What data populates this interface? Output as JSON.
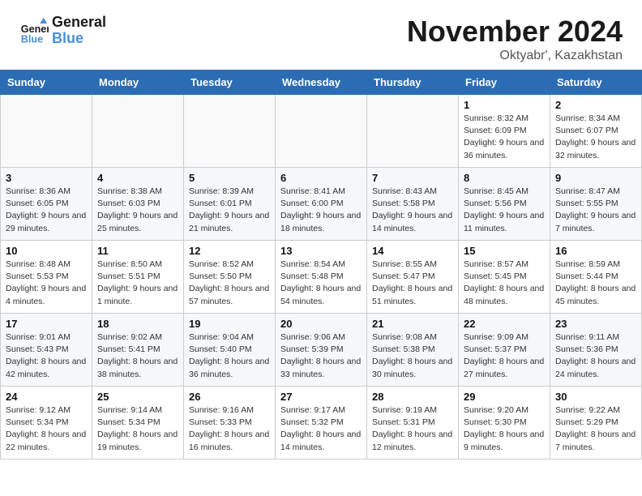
{
  "header": {
    "logo_line1": "General",
    "logo_line2": "Blue",
    "month": "November 2024",
    "location": "Oktyabr', Kazakhstan"
  },
  "weekdays": [
    "Sunday",
    "Monday",
    "Tuesday",
    "Wednesday",
    "Thursday",
    "Friday",
    "Saturday"
  ],
  "weeks": [
    [
      {
        "day": "",
        "info": ""
      },
      {
        "day": "",
        "info": ""
      },
      {
        "day": "",
        "info": ""
      },
      {
        "day": "",
        "info": ""
      },
      {
        "day": "",
        "info": ""
      },
      {
        "day": "1",
        "info": "Sunrise: 8:32 AM\nSunset: 6:09 PM\nDaylight: 9 hours and 36 minutes."
      },
      {
        "day": "2",
        "info": "Sunrise: 8:34 AM\nSunset: 6:07 PM\nDaylight: 9 hours and 32 minutes."
      }
    ],
    [
      {
        "day": "3",
        "info": "Sunrise: 8:36 AM\nSunset: 6:05 PM\nDaylight: 9 hours and 29 minutes."
      },
      {
        "day": "4",
        "info": "Sunrise: 8:38 AM\nSunset: 6:03 PM\nDaylight: 9 hours and 25 minutes."
      },
      {
        "day": "5",
        "info": "Sunrise: 8:39 AM\nSunset: 6:01 PM\nDaylight: 9 hours and 21 minutes."
      },
      {
        "day": "6",
        "info": "Sunrise: 8:41 AM\nSunset: 6:00 PM\nDaylight: 9 hours and 18 minutes."
      },
      {
        "day": "7",
        "info": "Sunrise: 8:43 AM\nSunset: 5:58 PM\nDaylight: 9 hours and 14 minutes."
      },
      {
        "day": "8",
        "info": "Sunrise: 8:45 AM\nSunset: 5:56 PM\nDaylight: 9 hours and 11 minutes."
      },
      {
        "day": "9",
        "info": "Sunrise: 8:47 AM\nSunset: 5:55 PM\nDaylight: 9 hours and 7 minutes."
      }
    ],
    [
      {
        "day": "10",
        "info": "Sunrise: 8:48 AM\nSunset: 5:53 PM\nDaylight: 9 hours and 4 minutes."
      },
      {
        "day": "11",
        "info": "Sunrise: 8:50 AM\nSunset: 5:51 PM\nDaylight: 9 hours and 1 minute."
      },
      {
        "day": "12",
        "info": "Sunrise: 8:52 AM\nSunset: 5:50 PM\nDaylight: 8 hours and 57 minutes."
      },
      {
        "day": "13",
        "info": "Sunrise: 8:54 AM\nSunset: 5:48 PM\nDaylight: 8 hours and 54 minutes."
      },
      {
        "day": "14",
        "info": "Sunrise: 8:55 AM\nSunset: 5:47 PM\nDaylight: 8 hours and 51 minutes."
      },
      {
        "day": "15",
        "info": "Sunrise: 8:57 AM\nSunset: 5:45 PM\nDaylight: 8 hours and 48 minutes."
      },
      {
        "day": "16",
        "info": "Sunrise: 8:59 AM\nSunset: 5:44 PM\nDaylight: 8 hours and 45 minutes."
      }
    ],
    [
      {
        "day": "17",
        "info": "Sunrise: 9:01 AM\nSunset: 5:43 PM\nDaylight: 8 hours and 42 minutes."
      },
      {
        "day": "18",
        "info": "Sunrise: 9:02 AM\nSunset: 5:41 PM\nDaylight: 8 hours and 38 minutes."
      },
      {
        "day": "19",
        "info": "Sunrise: 9:04 AM\nSunset: 5:40 PM\nDaylight: 8 hours and 36 minutes."
      },
      {
        "day": "20",
        "info": "Sunrise: 9:06 AM\nSunset: 5:39 PM\nDaylight: 8 hours and 33 minutes."
      },
      {
        "day": "21",
        "info": "Sunrise: 9:08 AM\nSunset: 5:38 PM\nDaylight: 8 hours and 30 minutes."
      },
      {
        "day": "22",
        "info": "Sunrise: 9:09 AM\nSunset: 5:37 PM\nDaylight: 8 hours and 27 minutes."
      },
      {
        "day": "23",
        "info": "Sunrise: 9:11 AM\nSunset: 5:36 PM\nDaylight: 8 hours and 24 minutes."
      }
    ],
    [
      {
        "day": "24",
        "info": "Sunrise: 9:12 AM\nSunset: 5:34 PM\nDaylight: 8 hours and 22 minutes."
      },
      {
        "day": "25",
        "info": "Sunrise: 9:14 AM\nSunset: 5:34 PM\nDaylight: 8 hours and 19 minutes."
      },
      {
        "day": "26",
        "info": "Sunrise: 9:16 AM\nSunset: 5:33 PM\nDaylight: 8 hours and 16 minutes."
      },
      {
        "day": "27",
        "info": "Sunrise: 9:17 AM\nSunset: 5:32 PM\nDaylight: 8 hours and 14 minutes."
      },
      {
        "day": "28",
        "info": "Sunrise: 9:19 AM\nSunset: 5:31 PM\nDaylight: 8 hours and 12 minutes."
      },
      {
        "day": "29",
        "info": "Sunrise: 9:20 AM\nSunset: 5:30 PM\nDaylight: 8 hours and 9 minutes."
      },
      {
        "day": "30",
        "info": "Sunrise: 9:22 AM\nSunset: 5:29 PM\nDaylight: 8 hours and 7 minutes."
      }
    ]
  ]
}
